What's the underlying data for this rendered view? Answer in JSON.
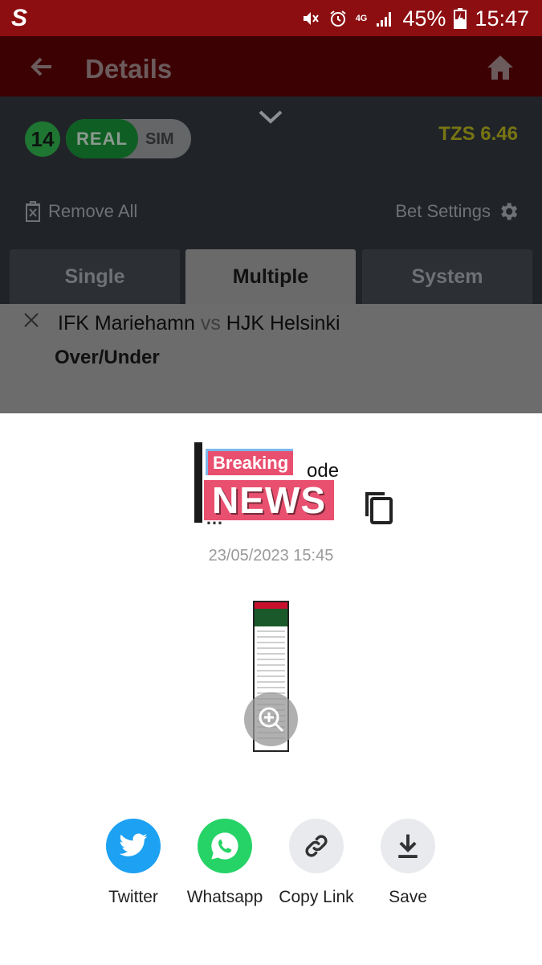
{
  "status_bar": {
    "battery": "45%",
    "time": "15:47",
    "network": "4G"
  },
  "app_bar": {
    "title": "Details"
  },
  "betslip": {
    "selection_count": "14",
    "mode_real": "REAL",
    "mode_sim": "SIM",
    "balance": "TZS 6.46",
    "remove_all": "Remove All",
    "bet_settings": "Bet Settings",
    "tabs": [
      {
        "label": "Single",
        "active": false
      },
      {
        "label": "Multiple",
        "active": true
      },
      {
        "label": "System",
        "active": false
      }
    ],
    "selection": {
      "home": "IFK Mariehamn",
      "vs": "vs",
      "away": "HJK Helsinki",
      "market": "Over/Under"
    }
  },
  "share_sheet": {
    "code_label": "ode",
    "code_value": "…",
    "overlay_breaking": "Breaking",
    "overlay_news": "NEWS",
    "date": "23/05/2023 15:45",
    "actions": [
      {
        "label": "Twitter",
        "icon": "twitter-icon",
        "color": "#1da1f2"
      },
      {
        "label": "Whatsapp",
        "icon": "whatsapp-icon",
        "color": "#25d366"
      },
      {
        "label": "Copy Link",
        "icon": "link-icon",
        "color": "#e8eaed"
      },
      {
        "label": "Save",
        "icon": "download-icon",
        "color": "#e8eaed"
      }
    ]
  },
  "colors": {
    "status_bar": "#8c0e11",
    "app_bar": "#3c0203",
    "panel": "#202428",
    "balance": "#787513",
    "real_toggle": "#0f5f24"
  }
}
